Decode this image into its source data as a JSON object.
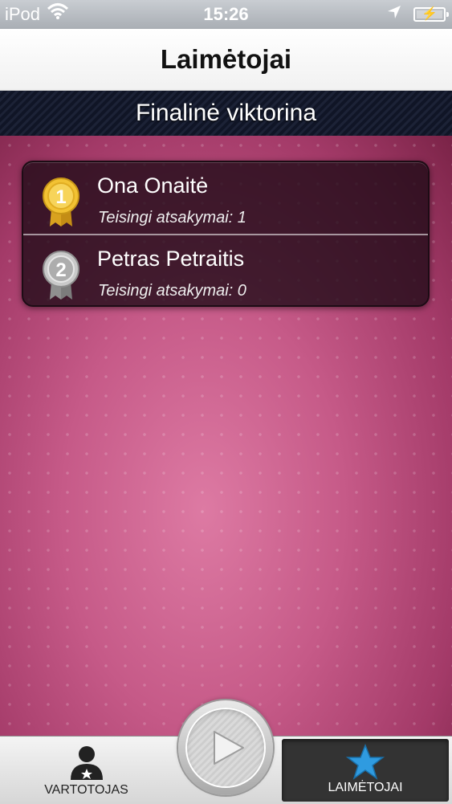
{
  "status_bar": {
    "carrier": "iPod",
    "time": "15:26"
  },
  "navbar": {
    "title": "Laimėtojai"
  },
  "section": {
    "title": "Finalinė viktorina"
  },
  "winners": [
    {
      "rank": "1",
      "name": "Ona Onaitė",
      "score_text": "Teisingi atsakymai: 1",
      "medal": "gold-medal-icon"
    },
    {
      "rank": "2",
      "name": "Petras Petraitis",
      "score_text": "Teisingi atsakymai: 0",
      "medal": "silver-medal-icon"
    }
  ],
  "tabbar": {
    "user_label": "VARTOTOJAS",
    "winners_label": "LAIMĖTOJAI",
    "selected": "winners"
  },
  "colors": {
    "gold": "#f2c233",
    "silver": "#b9b9b9",
    "star": "#2f9be0",
    "pink": "#c65a88"
  }
}
